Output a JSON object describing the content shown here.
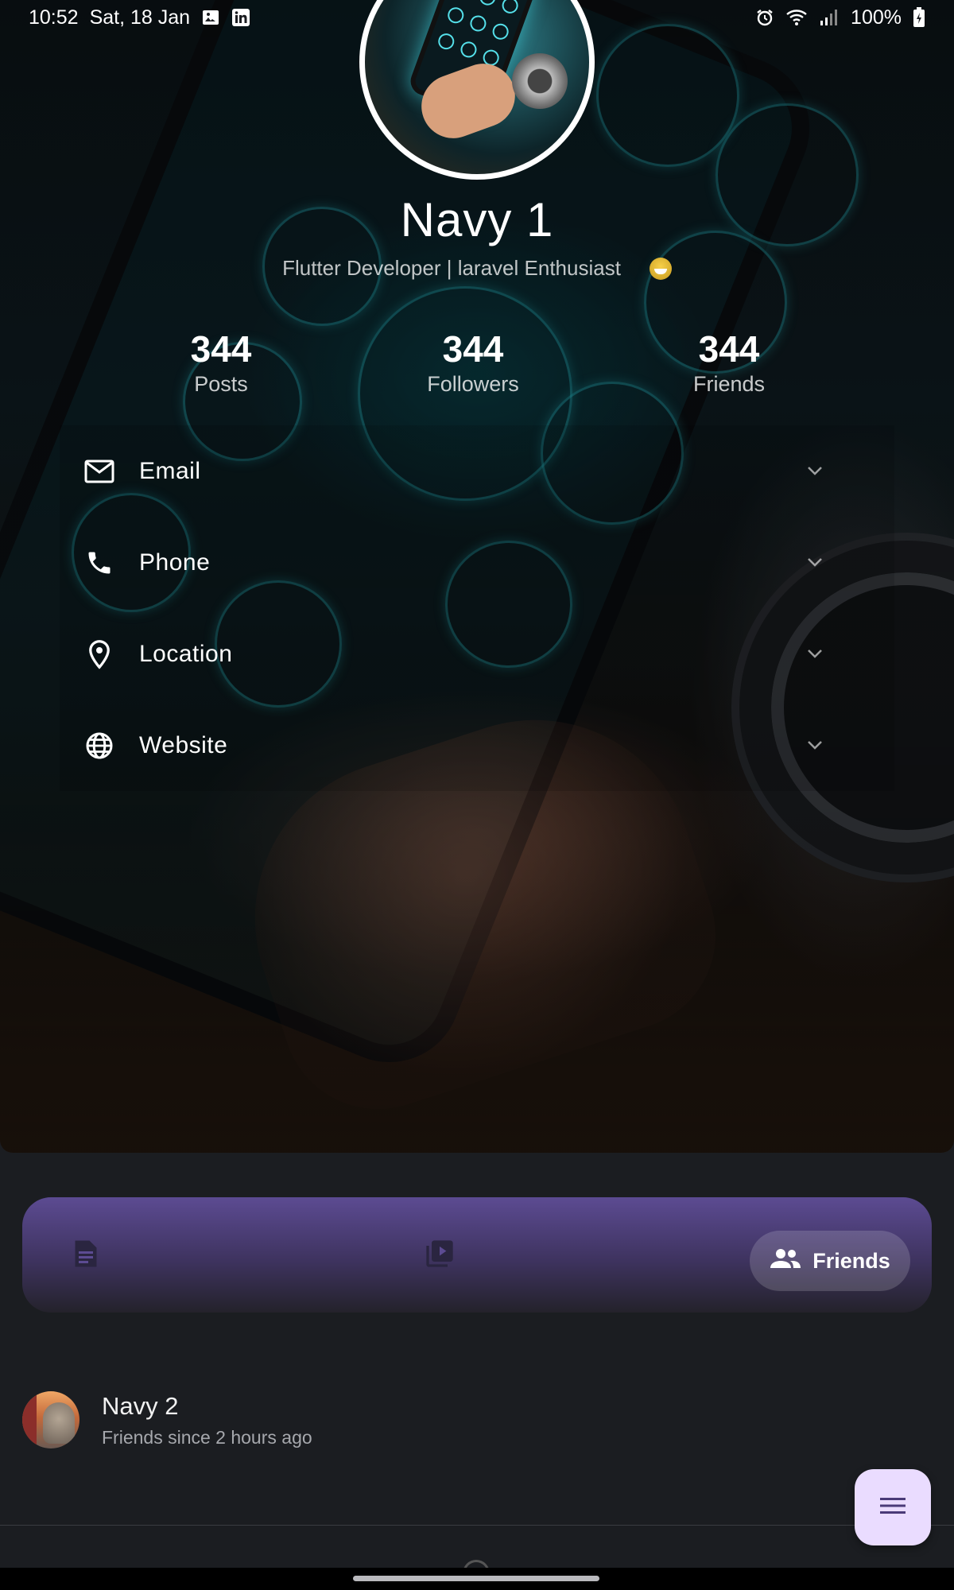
{
  "status_bar": {
    "time": "10:52",
    "date": "Sat, 18 Jan",
    "notification_icons": [
      "gallery-icon",
      "linkedin-icon"
    ],
    "system_icons": [
      "alarm-icon",
      "wifi-icon",
      "signal-icon",
      "battery-icon"
    ],
    "battery": "100%"
  },
  "profile": {
    "name": "Navy 1",
    "bio": "Flutter Developer | laravel Enthusiast",
    "bio_emoji": "grinning-face-emoji",
    "stats": [
      {
        "value": "344",
        "label": "Posts"
      },
      {
        "value": "344",
        "label": "Followers"
      },
      {
        "value": "344",
        "label": "Friends"
      }
    ]
  },
  "contacts": [
    {
      "label": "Email",
      "icon": "mail-icon"
    },
    {
      "label": "Phone",
      "icon": "phone-icon"
    },
    {
      "label": "Location",
      "icon": "location-pin-icon"
    },
    {
      "label": "Website",
      "icon": "globe-icon"
    }
  ],
  "tabs": {
    "posts_icon": "article-icon",
    "videos_icon": "video-library-icon",
    "friends_label": "Friends",
    "friends_icon": "group-icon",
    "selected": "Friends"
  },
  "friends": [
    {
      "name": "Navy 2",
      "subtitle": "Friends since 2 hours ago"
    }
  ],
  "fab_icon": "menu-icon",
  "colors": {
    "background": "#1b1d21",
    "tab_bar_accent": "#5c4b92",
    "fab": "#eadcff",
    "fab_icon": "#4a3a78"
  }
}
